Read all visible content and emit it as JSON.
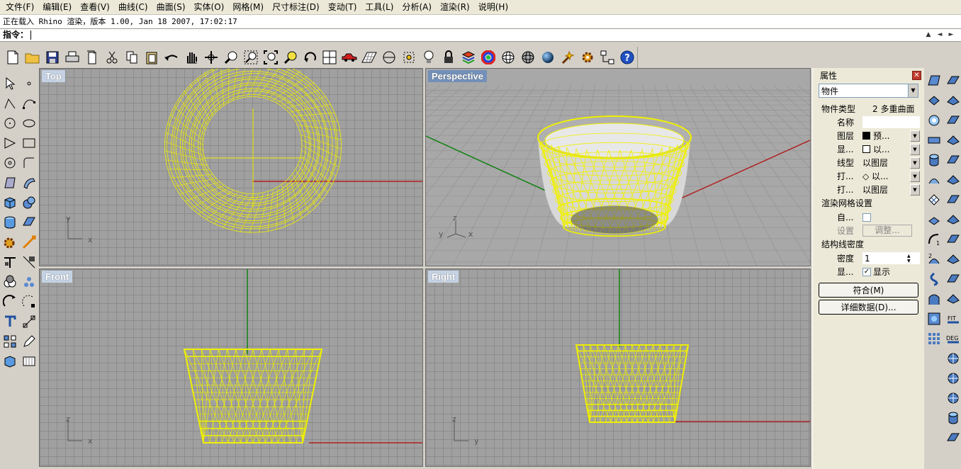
{
  "menu": [
    "文件(F)",
    "编辑(E)",
    "查看(V)",
    "曲线(C)",
    "曲面(S)",
    "实体(O)",
    "网格(M)",
    "尺寸标注(D)",
    "变动(T)",
    "工具(L)",
    "分析(A)",
    "渲染(R)",
    "说明(H)"
  ],
  "command_history": "正在载入 Rhino 渲染，版本 1.00, Jan 18 2007, 17:02:17",
  "command_prompt": "指令：",
  "toolbar_icons": [
    "new-file-icon",
    "open-folder-icon",
    "save-icon",
    "print-icon",
    "import-icon",
    "cut-icon",
    "copy-icon",
    "paste-icon",
    "undo-icon",
    "pan-hand-icon",
    "rotate-view-icon",
    "zoom-icon",
    "zoom-window-icon",
    "zoom-extents-icon",
    "zoom-selected-icon",
    "rotate-icon",
    "four-viewports-icon",
    "car-icon",
    "grid-icon",
    "ortho-icon",
    "snap-icon",
    "light-bulb-icon",
    "lock-icon",
    "layer-icon",
    "color-wheel-icon",
    "wireframe-sphere-icon",
    "ghosted-sphere-icon",
    "shaded-sphere-icon",
    "render-wand-icon",
    "settings-gear-icon",
    "network-icon",
    "help-icon"
  ],
  "viewports": {
    "top": {
      "title": "Top",
      "axis_x": "x",
      "axis_y": "y"
    },
    "perspective": {
      "title": "Perspective",
      "axis_x": "x",
      "axis_y": "y",
      "axis_z": "z"
    },
    "front": {
      "title": "Front",
      "axis_x": "x",
      "axis_z": "z"
    },
    "right": {
      "title": "Right",
      "axis_y": "y",
      "axis_z": "z"
    }
  },
  "properties": {
    "header": "属性",
    "dropdown": "物件",
    "object_type_label": "物件类型",
    "object_type_value": "2 多重曲面",
    "rows": [
      {
        "label": "名称",
        "value": ""
      },
      {
        "label": "图层",
        "value": "预..."
      },
      {
        "label": "显...",
        "value": "以..."
      },
      {
        "label": "线型",
        "value": "以图层"
      },
      {
        "label": "打...",
        "value": "◇ 以..."
      },
      {
        "label": "打...",
        "value": "以图层"
      }
    ],
    "render_mesh_section": "渲染网格设置",
    "auto_label": "自...",
    "settings_label": "设置",
    "adjust_button": "调整...",
    "isocurve_section": "结构线密度",
    "density_label": "密度",
    "density_value": "1",
    "show_label": "显...",
    "show_value": "显示",
    "match_button": "符合(M)",
    "details_button": "详细数据(D)..."
  },
  "colors": {
    "wire": "#f0f000",
    "x_axis": "#b02020",
    "y_axis": "#108010",
    "viewport_bg": "#a0a0a0",
    "title_active": "#7390b8"
  }
}
